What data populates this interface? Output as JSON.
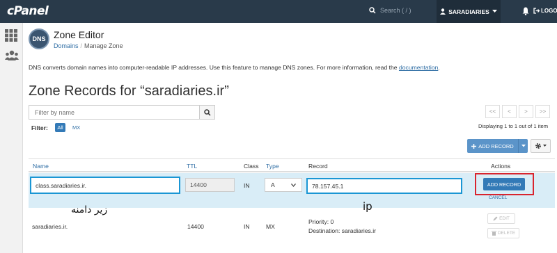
{
  "topbar": {
    "logo": "cPanel",
    "search_placeholder": "Search ( / )",
    "username": "SARADIARIES",
    "logout_label": "LOGOUT"
  },
  "header": {
    "badge": "DNS",
    "title": "Zone Editor",
    "breadcrumb": {
      "link": "Domains",
      "sep": "/",
      "current": "Manage Zone"
    }
  },
  "description": {
    "text": "DNS converts domain names into computer-readable IP addresses. Use this feature to manage DNS zones. For more information, read the ",
    "link": "documentation",
    "end": "."
  },
  "zone_heading": "Zone Records for “saradiaries.ir”",
  "filter": {
    "placeholder": "Filter by name",
    "label": "Filter:",
    "options": [
      "All",
      "MX"
    ]
  },
  "pagination": {
    "buttons": [
      "<<",
      "<",
      ">",
      ">>"
    ],
    "displaying": "Displaying 1 to 1 out of 1 item"
  },
  "toolbar": {
    "add_record_label": "ADD RECORD"
  },
  "table": {
    "headers": {
      "name": "Name",
      "ttl": "TTL",
      "class": "Class",
      "type": "Type",
      "record": "Record",
      "actions": "Actions"
    },
    "edit_row": {
      "name": "class.saradiaries.ir.",
      "ttl": "14400",
      "class": "IN",
      "type": "A",
      "record": "78.157.45.1",
      "add_button": "ADD RECORD",
      "cancel": "CANCEL"
    },
    "row": {
      "name": "saradiaries.ir.",
      "ttl": "14400",
      "class": "IN",
      "type": "MX",
      "priority": "Priority: 0",
      "destination": "Destination: saradiaries.ir",
      "edit": "EDIT",
      "delete": "DELETE"
    }
  },
  "annotations": {
    "subdomain": "زیر دامنه",
    "ip": "ip"
  },
  "colors": {
    "topbar": "#293a4a",
    "primary": "#337ab7",
    "highlight_border": "#1a96d4",
    "annotation_box": "#d9242e",
    "edit_row_bg": "#d9edf7"
  }
}
